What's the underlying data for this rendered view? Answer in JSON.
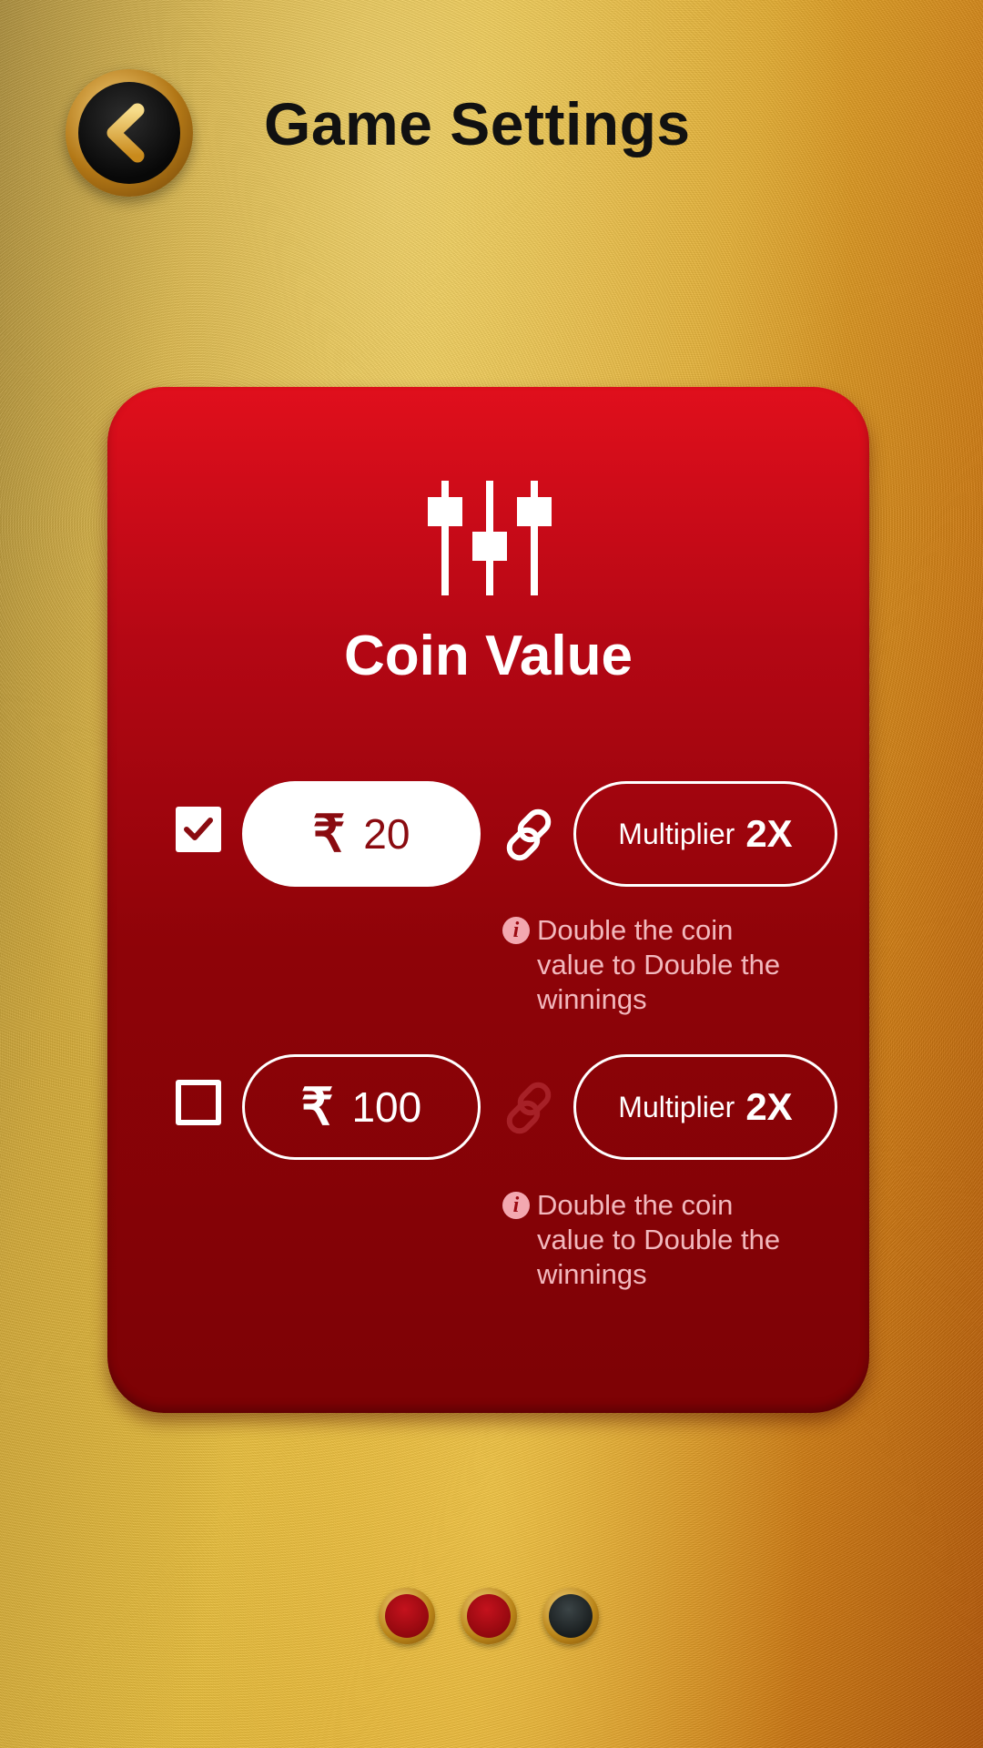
{
  "header": {
    "title": "Game Settings",
    "back_icon": "chevron-left-icon"
  },
  "card": {
    "icon": "sliders-icon",
    "title": "Coin Value",
    "options": [
      {
        "checked": true,
        "currency_symbol": "₹",
        "amount": "20",
        "link_icon": "link-icon",
        "link_active": true,
        "multiplier_label": "Multiplier",
        "multiplier_value": "2X",
        "info_text": "Double the coin value to Double the winnings"
      },
      {
        "checked": false,
        "currency_symbol": "₹",
        "amount": "100",
        "link_icon": "link-icon",
        "link_active": false,
        "multiplier_label": "Multiplier",
        "multiplier_value": "2X",
        "info_text": "Double the coin value to Double the winnings"
      }
    ]
  },
  "pagination": {
    "pages": 3,
    "active_page": 3
  },
  "colors": {
    "card_top": "#e00f1c",
    "card_bottom": "#7d0205",
    "active_pill_text": "#8a0b10",
    "info_text": "#f2b8bd",
    "gold": "#e9be3c"
  }
}
